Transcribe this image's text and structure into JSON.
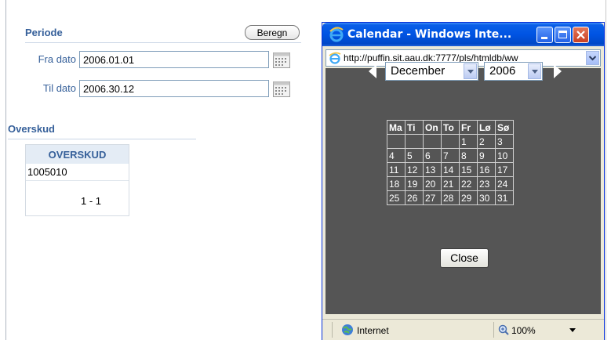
{
  "periode": {
    "title": "Periode",
    "calculate_button": "Beregn",
    "from_label": "Fra dato",
    "from_value": "2006.01.01",
    "to_label": "Til dato",
    "to_value": "2006.30.12"
  },
  "overskud": {
    "title": "Overskud",
    "column_header": "OVERSKUD",
    "rows": [
      "1005010"
    ],
    "pagination": "1 - 1"
  },
  "popup": {
    "title": "Calendar - Windows Inte...",
    "url": "http://puffin.sit.aau.dk:7777/pls/htmldb/ww",
    "month": "December",
    "year": "2006",
    "weekdays": [
      "Ma",
      "Ti",
      "On",
      "To",
      "Fr",
      "Lø",
      "Sø"
    ],
    "weeks": [
      [
        "",
        "",
        "",
        "",
        "1",
        "2",
        "3"
      ],
      [
        "4",
        "5",
        "6",
        "7",
        "8",
        "9",
        "10"
      ],
      [
        "11",
        "12",
        "13",
        "14",
        "15",
        "16",
        "17"
      ],
      [
        "18",
        "19",
        "20",
        "21",
        "22",
        "23",
        "24"
      ],
      [
        "25",
        "26",
        "27",
        "28",
        "29",
        "30",
        "31"
      ]
    ],
    "close_label": "Close",
    "status_zone": "Internet",
    "zoom": "100%"
  },
  "colors": {
    "accent": "#36609a",
    "calendar_bg": "#555555",
    "titlebar": "#0054e3"
  }
}
